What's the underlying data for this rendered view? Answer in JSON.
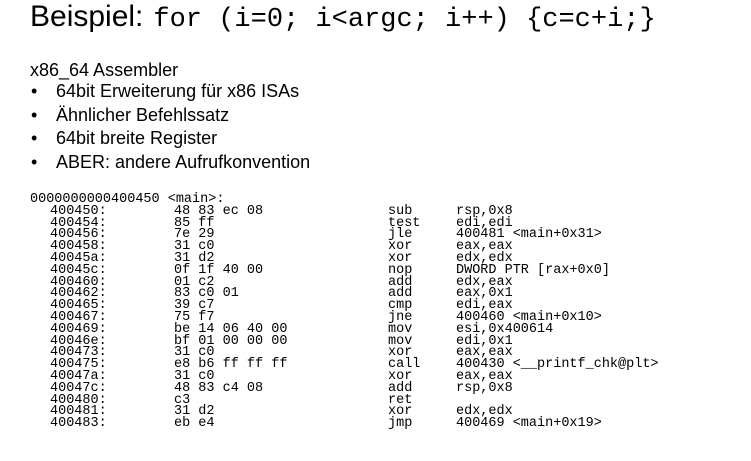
{
  "title": {
    "label": "Beispiel:",
    "code": "for (i=0; i<argc; i++) {c=c+i;}"
  },
  "intro": "x86_64 Assembler",
  "bullet_symbol": "•",
  "bullets": [
    "64bit Erweiterung für x86 ISAs",
    "Ähnlicher Befehlssatz",
    "64bit breite Register",
    "ABER: andere Aufrufkonvention"
  ],
  "disassembly": {
    "header": "0000000000400450 <main>:",
    "rows": [
      {
        "addr": "400450:",
        "bytes": "48 83 ec 08",
        "mnemonic": "sub",
        "operands": "rsp,0x8"
      },
      {
        "addr": "400454:",
        "bytes": "85 ff",
        "mnemonic": "test",
        "operands": "edi,edi"
      },
      {
        "addr": "400456:",
        "bytes": "7e 29",
        "mnemonic": "jle",
        "operands": "400481 <main+0x31>"
      },
      {
        "addr": "400458:",
        "bytes": "31 c0",
        "mnemonic": "xor",
        "operands": "eax,eax"
      },
      {
        "addr": "40045a:",
        "bytes": "31 d2",
        "mnemonic": "xor",
        "operands": "edx,edx"
      },
      {
        "addr": "40045c:",
        "bytes": "0f 1f 40 00",
        "mnemonic": "nop",
        "operands": "DWORD PTR [rax+0x0]"
      },
      {
        "addr": "400460:",
        "bytes": "01 c2",
        "mnemonic": "add",
        "operands": "edx,eax"
      },
      {
        "addr": "400462:",
        "bytes": "83 c0 01",
        "mnemonic": "add",
        "operands": "eax,0x1"
      },
      {
        "addr": "400465:",
        "bytes": "39 c7",
        "mnemonic": "cmp",
        "operands": "edi,eax"
      },
      {
        "addr": "400467:",
        "bytes": "75 f7",
        "mnemonic": "jne",
        "operands": "400460 <main+0x10>"
      },
      {
        "addr": "400469:",
        "bytes": "be 14 06 40 00",
        "mnemonic": "mov",
        "operands": "esi,0x400614"
      },
      {
        "addr": "40046e:",
        "bytes": "bf 01 00 00 00",
        "mnemonic": "mov",
        "operands": "edi,0x1"
      },
      {
        "addr": "400473:",
        "bytes": "31 c0",
        "mnemonic": "xor",
        "operands": "eax,eax"
      },
      {
        "addr": "400475:",
        "bytes": "e8 b6 ff ff ff",
        "mnemonic": "call",
        "operands": "400430 <__printf_chk@plt>"
      },
      {
        "addr": "40047a:",
        "bytes": "31 c0",
        "mnemonic": "xor",
        "operands": "eax,eax"
      },
      {
        "addr": "40047c:",
        "bytes": "48 83 c4 08",
        "mnemonic": "add",
        "operands": "rsp,0x8"
      },
      {
        "addr": "400480:",
        "bytes": "c3",
        "mnemonic": "ret",
        "operands": ""
      },
      {
        "addr": "400481:",
        "bytes": "31 d2",
        "mnemonic": "xor",
        "operands": "edx,edx"
      },
      {
        "addr": "400483:",
        "bytes": "eb e4",
        "mnemonic": "jmp",
        "operands": "400469 <main+0x19>"
      }
    ]
  }
}
